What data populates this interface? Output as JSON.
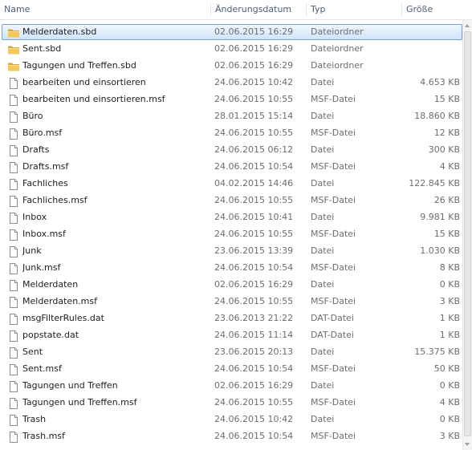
{
  "columns": {
    "name": "Name",
    "date": "Änderungsdatum",
    "type": "Typ",
    "size": "Größe"
  },
  "colors": {
    "selection_border": "#7da2ce",
    "selection_fill": "#cfe4fb",
    "folder": "#e8b84a"
  },
  "files": [
    {
      "name": "Melderdaten.sbd",
      "date": "02.06.2015 16:29",
      "type": "Dateiordner",
      "size": "",
      "icon": "folder-icon",
      "selected": true
    },
    {
      "name": "Sent.sbd",
      "date": "02.06.2015 16:29",
      "type": "Dateiordner",
      "size": "",
      "icon": "folder-icon"
    },
    {
      "name": "Tagungen und Treffen.sbd",
      "date": "02.06.2015 16:29",
      "type": "Dateiordner",
      "size": "",
      "icon": "folder-icon"
    },
    {
      "name": "bearbeiten und einsortieren",
      "date": "24.06.2015 10:42",
      "type": "Datei",
      "size": "4.653 KB",
      "icon": "file-icon"
    },
    {
      "name": "bearbeiten und einsortieren.msf",
      "date": "24.06.2015 10:55",
      "type": "MSF-Datei",
      "size": "15 KB",
      "icon": "file-icon"
    },
    {
      "name": "Büro",
      "date": "28.01.2015 15:14",
      "type": "Datei",
      "size": "18.860 KB",
      "icon": "file-icon"
    },
    {
      "name": "Büro.msf",
      "date": "24.06.2015 10:55",
      "type": "MSF-Datei",
      "size": "12 KB",
      "icon": "file-icon"
    },
    {
      "name": "Drafts",
      "date": "24.06.2015 06:12",
      "type": "Datei",
      "size": "300 KB",
      "icon": "file-icon"
    },
    {
      "name": "Drafts.msf",
      "date": "24.06.2015 10:54",
      "type": "MSF-Datei",
      "size": "4 KB",
      "icon": "file-icon"
    },
    {
      "name": "Fachliches",
      "date": "04.02.2015 14:46",
      "type": "Datei",
      "size": "122.845 KB",
      "icon": "file-icon"
    },
    {
      "name": "Fachliches.msf",
      "date": "24.06.2015 10:55",
      "type": "MSF-Datei",
      "size": "26 KB",
      "icon": "file-icon"
    },
    {
      "name": "Inbox",
      "date": "24.06.2015 10:41",
      "type": "Datei",
      "size": "9.981 KB",
      "icon": "file-icon"
    },
    {
      "name": "Inbox.msf",
      "date": "24.06.2015 10:55",
      "type": "MSF-Datei",
      "size": "15 KB",
      "icon": "file-icon"
    },
    {
      "name": "Junk",
      "date": "23.06.2015 13:39",
      "type": "Datei",
      "size": "1.030 KB",
      "icon": "file-icon"
    },
    {
      "name": "Junk.msf",
      "date": "24.06.2015 10:54",
      "type": "MSF-Datei",
      "size": "8 KB",
      "icon": "file-icon"
    },
    {
      "name": "Melderdaten",
      "date": "02.06.2015 16:29",
      "type": "Datei",
      "size": "0 KB",
      "icon": "file-icon"
    },
    {
      "name": "Melderdaten.msf",
      "date": "24.06.2015 10:55",
      "type": "MSF-Datei",
      "size": "3 KB",
      "icon": "file-icon"
    },
    {
      "name": "msgFilterRules.dat",
      "date": "23.06.2013 21:22",
      "type": "DAT-Datei",
      "size": "1 KB",
      "icon": "file-icon"
    },
    {
      "name": "popstate.dat",
      "date": "24.06.2015 11:14",
      "type": "DAT-Datei",
      "size": "1 KB",
      "icon": "file-icon"
    },
    {
      "name": "Sent",
      "date": "23.06.2015 20:13",
      "type": "Datei",
      "size": "15.375 KB",
      "icon": "file-icon"
    },
    {
      "name": "Sent.msf",
      "date": "24.06.2015 10:54",
      "type": "MSF-Datei",
      "size": "50 KB",
      "icon": "file-icon"
    },
    {
      "name": "Tagungen und Treffen",
      "date": "02.06.2015 16:29",
      "type": "Datei",
      "size": "0 KB",
      "icon": "file-icon"
    },
    {
      "name": "Tagungen und Treffen.msf",
      "date": "24.06.2015 10:55",
      "type": "MSF-Datei",
      "size": "4 KB",
      "icon": "file-icon"
    },
    {
      "name": "Trash",
      "date": "24.06.2015 10:42",
      "type": "Datei",
      "size": "0 KB",
      "icon": "file-icon"
    },
    {
      "name": "Trash.msf",
      "date": "24.06.2015 10:54",
      "type": "MSF-Datei",
      "size": "3 KB",
      "icon": "file-icon"
    }
  ]
}
